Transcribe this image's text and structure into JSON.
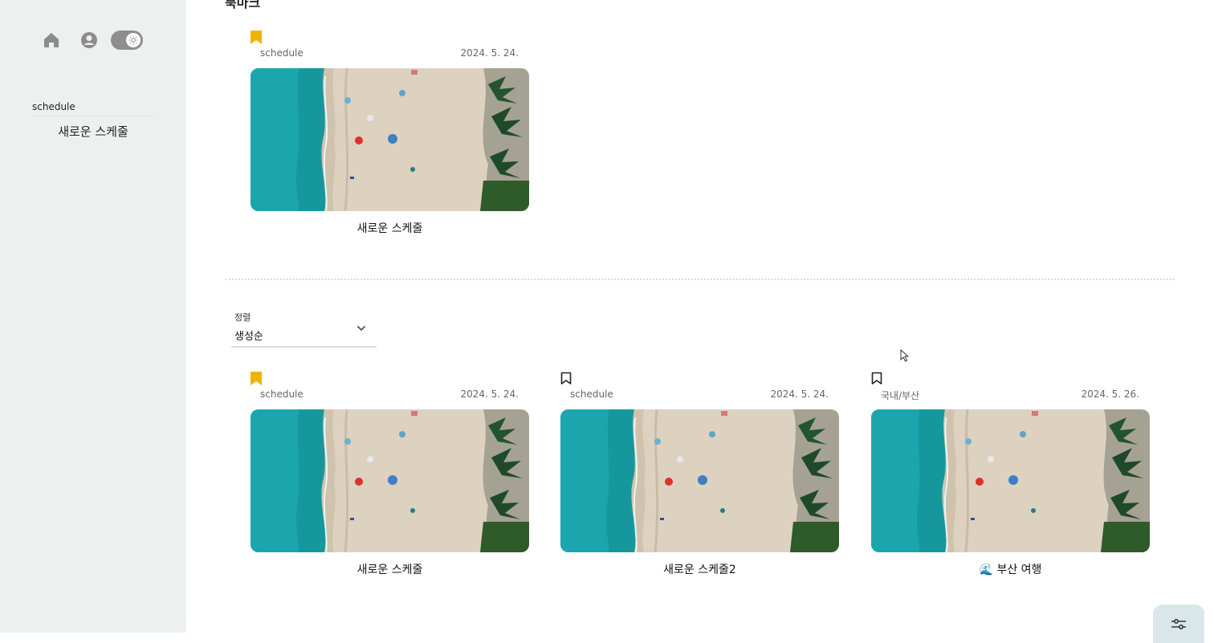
{
  "sidebar": {
    "icons": [
      "home-icon",
      "user-icon",
      "theme-toggle"
    ],
    "section_label": "schedule",
    "items": [
      {
        "label": "새로운 스케줄"
      }
    ]
  },
  "bookmarks": {
    "heading": "북마크",
    "cards": [
      {
        "category": "schedule",
        "date": "2024. 5. 24.",
        "title": "새로운 스케줄",
        "bookmarked": true
      }
    ]
  },
  "sort": {
    "label": "정렬",
    "value": "생성순"
  },
  "schedules": [
    {
      "category": "schedule",
      "date": "2024. 5. 24.",
      "title": "새로운 스케줄",
      "bookmarked": true
    },
    {
      "category": "schedule",
      "date": "2024. 5. 24.",
      "title": "새로운 스케줄2",
      "bookmarked": false
    },
    {
      "category": "국내/부산",
      "date": "2024. 5. 26.",
      "title": "🌊 부산 여행",
      "bookmarked": false
    }
  ],
  "colors": {
    "sidebar_bg": "#ecf1f0",
    "bookmark_active": "#f0b400",
    "fab_bg": "#d9e7ea",
    "sea": "#1a9da3",
    "sand": "#ddd1c0"
  },
  "fab": {
    "icon": "sliders-icon"
  }
}
